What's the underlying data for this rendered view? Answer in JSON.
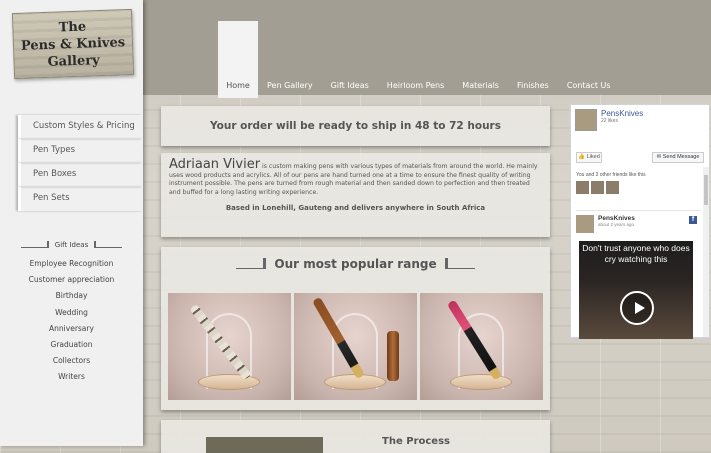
{
  "logo": {
    "line1": "The",
    "line2": "Pens & Knives",
    "line3": "Gallery"
  },
  "nav": {
    "items": [
      "Home",
      "Pen Gallery",
      "Gift Ideas",
      "Heirloom Pens",
      "Materials",
      "Finishes",
      "Contact Us"
    ],
    "active": "Home"
  },
  "sidebar": {
    "items": [
      "Custom Styles & Pricing",
      "Pen Types",
      "Pen Boxes",
      "Pen Sets"
    ],
    "gift_title": "Gift Ideas",
    "gift_items": [
      "Employee Recognition",
      "Customer appreciation",
      "Birthday",
      "Wedding",
      "Anniversary",
      "Graduation",
      "Collectors",
      "Writers"
    ]
  },
  "main": {
    "ship_text": "Your order will be ready to ship in 48 to 72 hours",
    "intro_name": "Adriaan Vivier",
    "intro_text": " is custom making pens with various types of materials from around the world. He mainly uses wood products and acrylics. All of our pens are hand turned one at a time to ensure the finest quality of writing instrument possible. The pens are turned from rough material and then sanded down to perfection and then treated and buffed for a long lasting writing experience.",
    "based_text": "Based in Lonehill, Gauteng and delivers anywhere in South Africa",
    "range_title": "Our most popular range",
    "process_title": "The Process"
  },
  "facebook": {
    "page_name": "PensKnives",
    "likes": "22 likes",
    "like_label": "Liked",
    "message_label": "Send Message",
    "friends_text": "You and 3 other friends like this",
    "post_name": "PensKnives",
    "post_date": "about 2 years ago",
    "video_text": "Don't trust anyone who does cry watching this"
  },
  "colors": {
    "header": "#a29e94",
    "sidebar": "#f0f0f0",
    "fb_blue": "#3b5998"
  }
}
